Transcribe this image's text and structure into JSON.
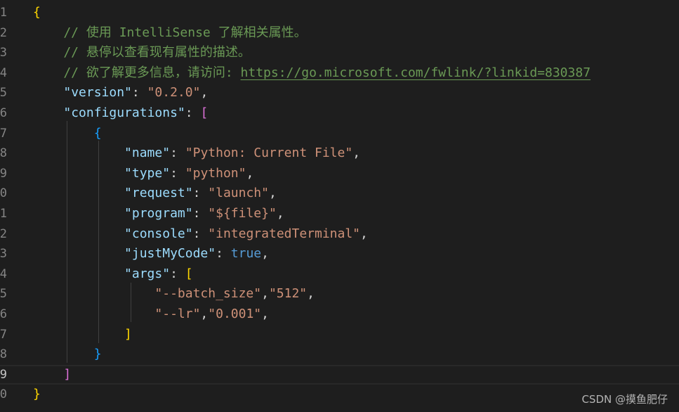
{
  "editor": {
    "language": "json",
    "current_line": 19,
    "lines": [
      {
        "number": "1",
        "tokens": [
          {
            "t": "{",
            "c": "brace-gold"
          }
        ]
      },
      {
        "number": "2",
        "tokens": [
          {
            "t": "    // 使用 IntelliSense 了解相关属性。",
            "c": "comment"
          }
        ]
      },
      {
        "number": "3",
        "tokens": [
          {
            "t": "    // 悬停以查看现有属性的描述。",
            "c": "comment"
          }
        ]
      },
      {
        "number": "4",
        "tokens": [
          {
            "t": "    // 欲了解更多信息，请访问: ",
            "c": "comment"
          },
          {
            "t": "https://go.microsoft.com/fwlink/?linkid=830387",
            "c": "link"
          }
        ]
      },
      {
        "number": "5",
        "tokens": [
          {
            "t": "    ",
            "c": "punc"
          },
          {
            "t": "\"version\"",
            "c": "key"
          },
          {
            "t": ": ",
            "c": "punc"
          },
          {
            "t": "\"0.2.0\"",
            "c": "str"
          },
          {
            "t": ",",
            "c": "punc"
          }
        ]
      },
      {
        "number": "6",
        "tokens": [
          {
            "t": "    ",
            "c": "punc"
          },
          {
            "t": "\"configurations\"",
            "c": "key"
          },
          {
            "t": ": ",
            "c": "punc"
          },
          {
            "t": "[",
            "c": "brace-pink"
          }
        ]
      },
      {
        "number": "7",
        "tokens": [
          {
            "t": "        ",
            "c": "punc"
          },
          {
            "t": "{",
            "c": "brace-blue"
          }
        ]
      },
      {
        "number": "8",
        "tokens": [
          {
            "t": "            ",
            "c": "punc"
          },
          {
            "t": "\"name\"",
            "c": "key"
          },
          {
            "t": ": ",
            "c": "punc"
          },
          {
            "t": "\"Python: Current File\"",
            "c": "str"
          },
          {
            "t": ",",
            "c": "punc"
          }
        ]
      },
      {
        "number": "9",
        "tokens": [
          {
            "t": "            ",
            "c": "punc"
          },
          {
            "t": "\"type\"",
            "c": "key"
          },
          {
            "t": ": ",
            "c": "punc"
          },
          {
            "t": "\"python\"",
            "c": "str"
          },
          {
            "t": ",",
            "c": "punc"
          }
        ]
      },
      {
        "number": "0",
        "tokens": [
          {
            "t": "            ",
            "c": "punc"
          },
          {
            "t": "\"request\"",
            "c": "key"
          },
          {
            "t": ": ",
            "c": "punc"
          },
          {
            "t": "\"launch\"",
            "c": "str"
          },
          {
            "t": ",",
            "c": "punc"
          }
        ]
      },
      {
        "number": "1",
        "tokens": [
          {
            "t": "            ",
            "c": "punc"
          },
          {
            "t": "\"program\"",
            "c": "key"
          },
          {
            "t": ": ",
            "c": "punc"
          },
          {
            "t": "\"${file}\"",
            "c": "str"
          },
          {
            "t": ",",
            "c": "punc"
          }
        ]
      },
      {
        "number": "2",
        "tokens": [
          {
            "t": "            ",
            "c": "punc"
          },
          {
            "t": "\"console\"",
            "c": "key"
          },
          {
            "t": ": ",
            "c": "punc"
          },
          {
            "t": "\"integratedTerminal\"",
            "c": "str"
          },
          {
            "t": ",",
            "c": "punc"
          }
        ]
      },
      {
        "number": "3",
        "tokens": [
          {
            "t": "            ",
            "c": "punc"
          },
          {
            "t": "\"justMyCode\"",
            "c": "key"
          },
          {
            "t": ": ",
            "c": "punc"
          },
          {
            "t": "true",
            "c": "bool"
          },
          {
            "t": ",",
            "c": "punc"
          }
        ]
      },
      {
        "number": "4",
        "tokens": [
          {
            "t": "            ",
            "c": "punc"
          },
          {
            "t": "\"args\"",
            "c": "key"
          },
          {
            "t": ": ",
            "c": "punc"
          },
          {
            "t": "[",
            "c": "brace-gold"
          }
        ]
      },
      {
        "number": "5",
        "tokens": [
          {
            "t": "                ",
            "c": "punc"
          },
          {
            "t": "\"--batch_size\"",
            "c": "str"
          },
          {
            "t": ",",
            "c": "punc"
          },
          {
            "t": "\"512\"",
            "c": "str"
          },
          {
            "t": ",",
            "c": "punc"
          }
        ]
      },
      {
        "number": "6",
        "tokens": [
          {
            "t": "                ",
            "c": "punc"
          },
          {
            "t": "\"--lr\"",
            "c": "str"
          },
          {
            "t": ",",
            "c": "punc"
          },
          {
            "t": "\"0.001\"",
            "c": "str"
          },
          {
            "t": ",",
            "c": "punc"
          }
        ]
      },
      {
        "number": "7",
        "tokens": [
          {
            "t": "            ",
            "c": "punc"
          },
          {
            "t": "]",
            "c": "brace-gold"
          }
        ]
      },
      {
        "number": "8",
        "tokens": [
          {
            "t": "        ",
            "c": "punc"
          },
          {
            "t": "}",
            "c": "brace-blue"
          }
        ]
      },
      {
        "number": "9",
        "tokens": [
          {
            "t": "    ",
            "c": "punc"
          },
          {
            "t": "]",
            "c": "brace-pink"
          }
        ]
      },
      {
        "number": "0",
        "tokens": [
          {
            "t": "}",
            "c": "brace-gold"
          }
        ]
      }
    ]
  },
  "colors": {
    "background": "#1e1e1e",
    "key": "#9cdcfe",
    "string": "#ce9178",
    "boolean": "#569cd6",
    "comment": "#6a9955",
    "bracket_level1": "#ffd700",
    "bracket_level2": "#da70d6",
    "bracket_level3": "#179fff"
  },
  "watermark": {
    "text": "CSDN @摸鱼肥仔"
  }
}
